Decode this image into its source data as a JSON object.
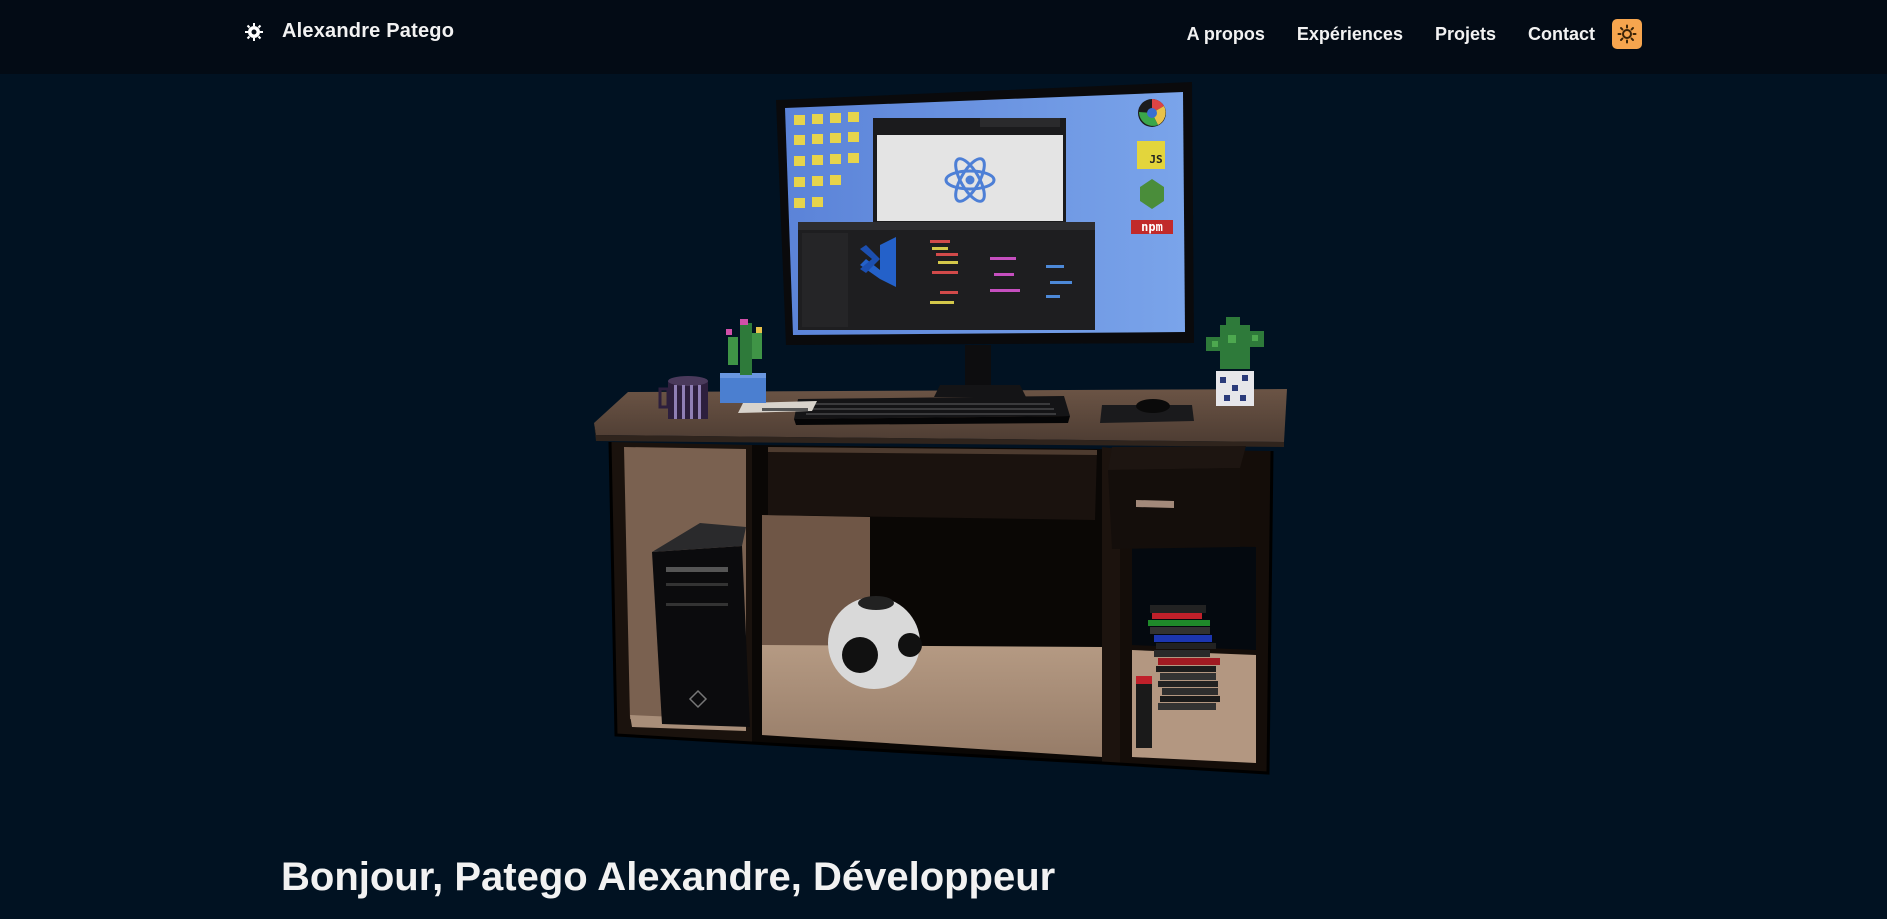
{
  "header": {
    "brand_name": "Alexandre Patego",
    "nav": [
      {
        "label": "A propos"
      },
      {
        "label": "Expériences"
      },
      {
        "label": "Projets"
      },
      {
        "label": "Contact"
      }
    ],
    "theme_toggle_icon": "sun-icon",
    "theme_toggle_color": "#f6a54e"
  },
  "scene": {
    "monitor_icons": {
      "js_badge": "JS",
      "npm_badge": "npm"
    }
  },
  "hero": {
    "title": "Bonjour, Patego Alexandre, Développeur"
  },
  "colors": {
    "background": "#011222",
    "header": "#030b15",
    "accent": "#f6a54e"
  }
}
